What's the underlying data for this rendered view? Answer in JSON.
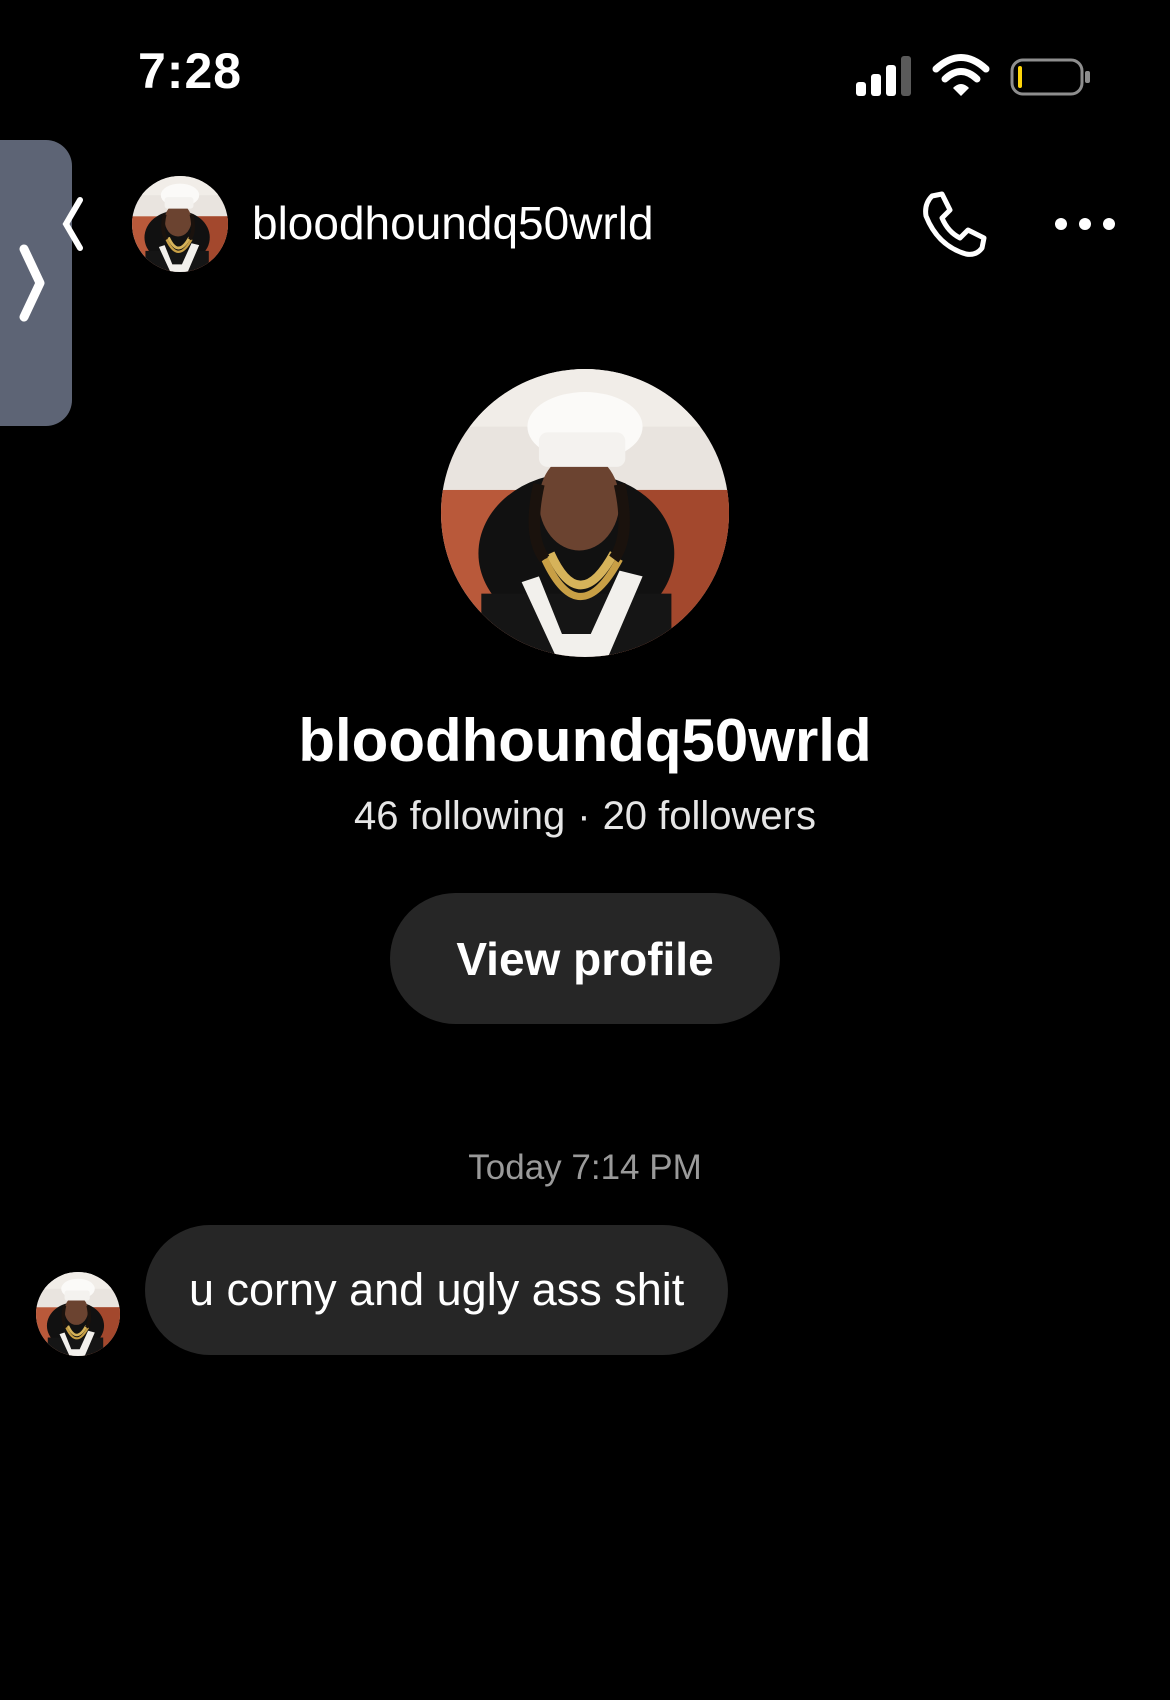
{
  "status_bar": {
    "time": "7:28",
    "signal_icon": "cellular-signal-icon",
    "wifi_icon": "wifi-icon",
    "battery_icon": "battery-low-icon",
    "battery_level": 0.05
  },
  "side_tab": {
    "icon": "chevron-right-icon"
  },
  "header": {
    "username": "bloodhoundq50wrld",
    "back_icon": "chevron-left-icon",
    "call_icon": "phone-icon",
    "more_icon": "more-horizontal-icon"
  },
  "profile": {
    "username": "bloodhoundq50wrld",
    "following": "46 following",
    "separator": "·",
    "followers": "20 followers",
    "view_profile_label": "View profile"
  },
  "conversation": {
    "timestamp": "Today 7:14 PM",
    "messages": [
      {
        "text": "u corny and ugly ass shit"
      }
    ]
  },
  "colors": {
    "background": "#000000",
    "bubble": "#262626",
    "side_tab": "#5d6475",
    "battery_low": "#ffd60a"
  }
}
